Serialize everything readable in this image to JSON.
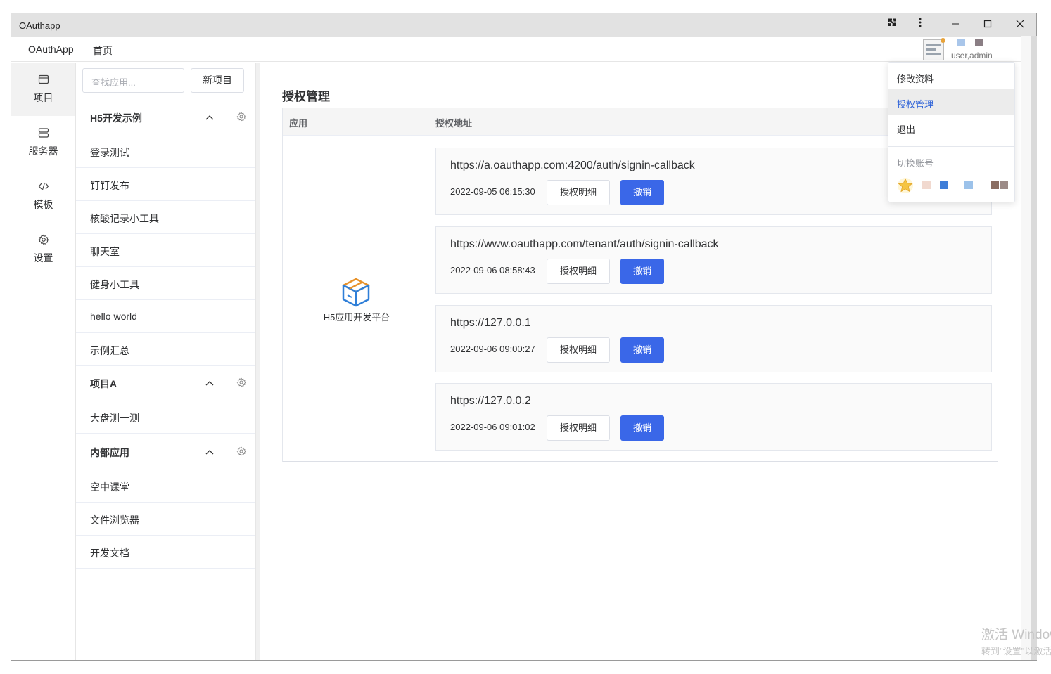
{
  "window": {
    "title": "OAuthapp"
  },
  "menubar": {
    "app_name": "OAuthApp",
    "home": "首页",
    "user_sub": "user,admin"
  },
  "nav": {
    "items": [
      {
        "label": "项目",
        "icon": "window-icon"
      },
      {
        "label": "服务器",
        "icon": "server-icon"
      },
      {
        "label": "模板",
        "icon": "code-icon"
      },
      {
        "label": "设置",
        "icon": "gear-icon"
      }
    ]
  },
  "projects": {
    "search_placeholder": "查找应用...",
    "new_label": "新项目",
    "groups": [
      {
        "title": "H5开发示例",
        "items": [
          "登录测试",
          "钉钉发布",
          "核酸记录小工具",
          "聊天室",
          "健身小工具",
          "hello world",
          "示例汇总"
        ]
      },
      {
        "title": "项目A",
        "items": [
          "大盘测一测"
        ]
      },
      {
        "title": "内部应用",
        "items": [
          "空中课堂",
          "文件浏览器",
          "开发文档"
        ]
      }
    ]
  },
  "auth": {
    "title": "授权管理",
    "col_app": "应用",
    "col_url": "授权地址",
    "app_name": "H5应用开发平台",
    "entries": [
      {
        "url": "https://a.oauthapp.com:4200/auth/signin-callback",
        "time": "2022-09-05 06:15:30",
        "detail": "授权明细",
        "revoke": "撤销"
      },
      {
        "url": "https://www.oauthapp.com/tenant/auth/signin-callback",
        "time": "2022-09-06 08:58:43",
        "detail": "授权明细",
        "revoke": "撤销"
      },
      {
        "url": "https://127.0.0.1",
        "time": "2022-09-06 09:00:27",
        "detail": "授权明细",
        "revoke": "撤销"
      },
      {
        "url": "https://127.0.0.2",
        "time": "2022-09-06 09:01:02",
        "detail": "授权明细",
        "revoke": "撤销"
      }
    ]
  },
  "dropdown": {
    "items": [
      "修改资料",
      "授权管理",
      "退出"
    ],
    "active": "授权管理",
    "switch_label": "切换账号"
  },
  "watermark": {
    "line1": "激活 Windows",
    "line2": "转到\"设置\"以激活 Windows。"
  },
  "colors": {
    "accent": "#3a67e8",
    "active_link": "#2f63d8"
  }
}
